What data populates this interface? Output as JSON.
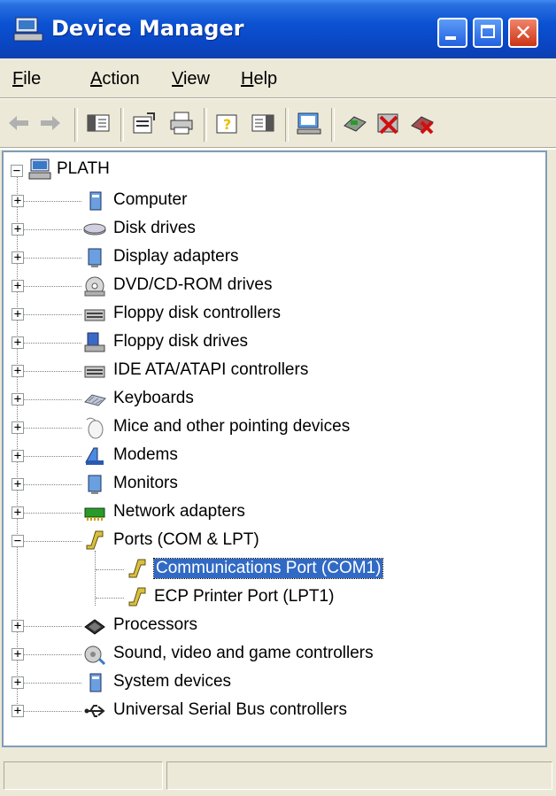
{
  "window": {
    "title": "Device Manager",
    "buttons": {
      "minimize": "minimize",
      "maximize": "maximize",
      "close": "close"
    }
  },
  "menu": [
    {
      "pre": "",
      "ul": "F",
      "post": "ile"
    },
    {
      "pre": "",
      "ul": "A",
      "post": "ction"
    },
    {
      "pre": "",
      "ul": "V",
      "post": "iew"
    },
    {
      "pre": "",
      "ul": "H",
      "post": "elp"
    }
  ],
  "toolbar": {
    "icons": [
      "back-arrow-icon",
      "forward-arrow-icon",
      "show-hide-console-tree-icon",
      "properties-icon",
      "print-icon",
      "help-icon",
      "show-hide-action-pane-icon",
      "scan-hardware-icon",
      "update-driver-icon",
      "disable-device-icon",
      "uninstall-device-icon"
    ]
  },
  "tree": {
    "root": "PLATH",
    "categories": [
      {
        "label": "Computer",
        "icon": "computer-icon",
        "expanded": false
      },
      {
        "label": "Disk drives",
        "icon": "disk-drive-icon",
        "expanded": false
      },
      {
        "label": "Display adapters",
        "icon": "display-adapter-icon",
        "expanded": false
      },
      {
        "label": "DVD/CD-ROM drives",
        "icon": "dvd-drive-icon",
        "expanded": false
      },
      {
        "label": "Floppy disk controllers",
        "icon": "floppy-controller-icon",
        "expanded": false
      },
      {
        "label": "Floppy disk drives",
        "icon": "floppy-drive-icon",
        "expanded": false
      },
      {
        "label": "IDE ATA/ATAPI controllers",
        "icon": "ide-controller-icon",
        "expanded": false
      },
      {
        "label": "Keyboards",
        "icon": "keyboard-icon",
        "expanded": false
      },
      {
        "label": "Mice and other pointing devices",
        "icon": "mouse-icon",
        "expanded": false
      },
      {
        "label": "Modems",
        "icon": "modem-icon",
        "expanded": false
      },
      {
        "label": "Monitors",
        "icon": "monitor-icon",
        "expanded": false
      },
      {
        "label": "Network adapters",
        "icon": "network-adapter-icon",
        "expanded": false
      },
      {
        "label": "Ports (COM & LPT)",
        "icon": "port-icon",
        "expanded": true,
        "children": [
          {
            "label": "Communications Port (COM1)",
            "icon": "port-icon",
            "selected": true
          },
          {
            "label": "ECP Printer Port (LPT1)",
            "icon": "port-icon",
            "selected": false
          }
        ]
      },
      {
        "label": "Processors",
        "icon": "processor-icon",
        "expanded": false
      },
      {
        "label": "Sound, video and game controllers",
        "icon": "sound-icon",
        "expanded": false
      },
      {
        "label": "System devices",
        "icon": "system-devices-icon",
        "expanded": false
      },
      {
        "label": "Universal Serial Bus controllers",
        "icon": "usb-icon",
        "expanded": false
      }
    ]
  },
  "colors": {
    "titlebar": "#0b52d3",
    "selection": "#316ac5",
    "face": "#ece9d8"
  }
}
